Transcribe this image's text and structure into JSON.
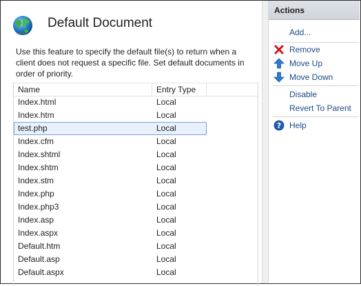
{
  "page": {
    "title": "Default Document",
    "description": "Use this feature to specify the default file(s) to return when a client does not request a specific file. Set default documents in order of priority."
  },
  "table": {
    "columns": [
      "Name",
      "Entry Type"
    ],
    "rows": [
      {
        "name": "Index.html",
        "type": "Local"
      },
      {
        "name": "Index.htm",
        "type": "Local"
      },
      {
        "name": "test.php",
        "type": "Local",
        "selected": true
      },
      {
        "name": "Index.cfm",
        "type": "Local"
      },
      {
        "name": "Index.shtml",
        "type": "Local"
      },
      {
        "name": "Index.shtm",
        "type": "Local"
      },
      {
        "name": "Index.stm",
        "type": "Local"
      },
      {
        "name": "Index.php",
        "type": "Local"
      },
      {
        "name": "Index.php3",
        "type": "Local"
      },
      {
        "name": "Index.asp",
        "type": "Local"
      },
      {
        "name": "Index.aspx",
        "type": "Local"
      },
      {
        "name": "Default.htm",
        "type": "Local"
      },
      {
        "name": "Default.asp",
        "type": "Local"
      },
      {
        "name": "Default.aspx",
        "type": "Local"
      }
    ]
  },
  "actions": {
    "header": "Actions",
    "add": "Add...",
    "remove": "Remove",
    "move_up": "Move Up",
    "move_down": "Move Down",
    "disable": "Disable",
    "revert": "Revert To Parent",
    "help": "Help"
  },
  "colors": {
    "link": "#1a4b86",
    "remove_icon": "#d0161b",
    "arrow_icon": "#2a7bd1",
    "selected_bg": "#e8f0fb"
  }
}
